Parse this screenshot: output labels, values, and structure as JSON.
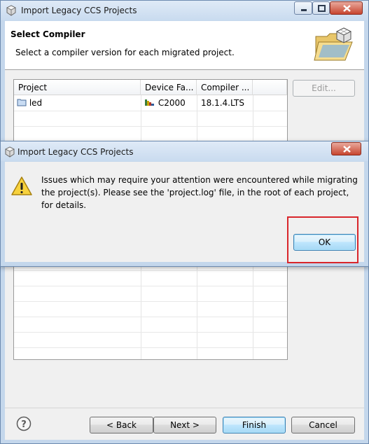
{
  "window": {
    "title": "Import Legacy CCS Projects"
  },
  "wizard": {
    "header_title": "Select Compiler",
    "header_description": "Select a compiler version for each migrated project."
  },
  "table": {
    "columns": [
      "Project",
      "Device Fa...",
      "Compiler ..."
    ],
    "rows": [
      {
        "project": "led",
        "device_family": "C2000",
        "compiler": "18.1.4.LTS"
      }
    ]
  },
  "buttons": {
    "edit": "Edit...",
    "back": "< Back",
    "next": "Next >",
    "finish": "Finish",
    "cancel": "Cancel"
  },
  "dialog": {
    "title": "Import Legacy CCS Projects",
    "message": "Issues which may require your attention were encountered while migrating the project(s). Please see the 'project.log' file, in the root of each project, for details.",
    "ok": "OK"
  },
  "colors": {
    "highlight_box": "#d9262b",
    "default_button_border": "#3c7fb1"
  }
}
